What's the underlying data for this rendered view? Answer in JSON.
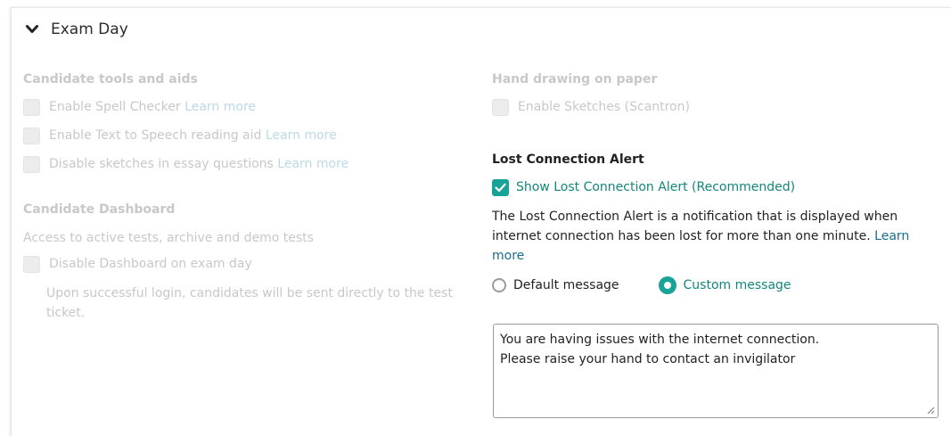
{
  "section": {
    "title": "Exam Day"
  },
  "tools": {
    "title": "Candidate tools and aids",
    "items": [
      {
        "label": "Enable Spell Checker",
        "link": "Learn more"
      },
      {
        "label": "Enable Text to Speech reading aid",
        "link": "Learn more"
      },
      {
        "label": "Disable sketches in essay questions",
        "link": "Learn more"
      }
    ]
  },
  "dashboard": {
    "title": "Candidate Dashboard",
    "description": "Access to active tests, archive and demo tests",
    "checkbox_label": "Disable Dashboard on exam day",
    "note": "Upon successful login, candidates will be sent directly to the test ticket."
  },
  "drawing": {
    "title": "Hand drawing on paper",
    "checkbox_label": "Enable Sketches (Scantron)"
  },
  "alert": {
    "title": "Lost Connection Alert",
    "checkbox_label": "Show Lost Connection Alert (Recommended)",
    "description": "The Lost Connection Alert is a notification that is displayed when internet connection has been lost for more than one minute.",
    "link": "Learn more",
    "radio_default": "Default message",
    "radio_custom": "Custom message",
    "message_line1": "You are having issues with the internet connection.",
    "message_line2": "Please raise your hand to contact an invigilator"
  },
  "colors": {
    "accent": "#17a398",
    "link": "#1a6d8e",
    "disabled": "#c8c8c8"
  }
}
